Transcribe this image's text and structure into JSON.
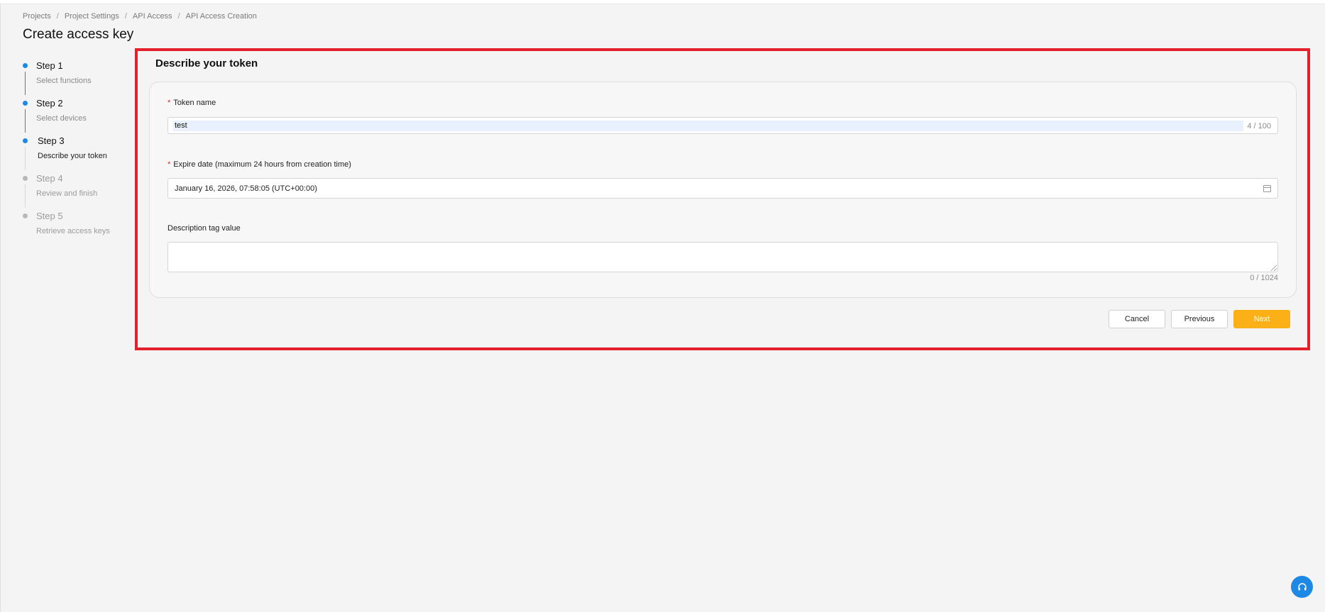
{
  "breadcrumb": [
    "Projects",
    "Project Settings",
    "API Access",
    "API Access Creation"
  ],
  "breadcrumb_separator": "/",
  "page_title": "Create access key",
  "steps": [
    {
      "title": "Step 1",
      "subtitle": "Select functions",
      "state": "done"
    },
    {
      "title": "Step 2",
      "subtitle": "Select devices",
      "state": "done"
    },
    {
      "title": "Step 3",
      "subtitle": "Describe your token",
      "state": "current"
    },
    {
      "title": "Step 4",
      "subtitle": "Review and finish",
      "state": "pending"
    },
    {
      "title": "Step 5",
      "subtitle": "Retrieve access keys",
      "state": "pending"
    }
  ],
  "form": {
    "section_title": "Describe your token",
    "required_mark": "*",
    "token_name": {
      "label": "Token name",
      "value": "test",
      "counter": "4 / 100"
    },
    "expire_date": {
      "label": "Expire date (maximum 24 hours from creation time)",
      "value": "January 16, 2026, 07:58:05 (UTC+00:00)"
    },
    "description": {
      "label": "Description tag value",
      "value": "",
      "counter": "0 / 1024"
    }
  },
  "buttons": {
    "cancel": "Cancel",
    "previous": "Previous",
    "next": "Next"
  },
  "icons": {
    "calendar": "calendar-icon",
    "help": "headset-icon"
  },
  "colors": {
    "accent": "#1e88e5",
    "primary_button": "#fbb018",
    "highlight": "#e3202b",
    "required": "#e3202b"
  }
}
